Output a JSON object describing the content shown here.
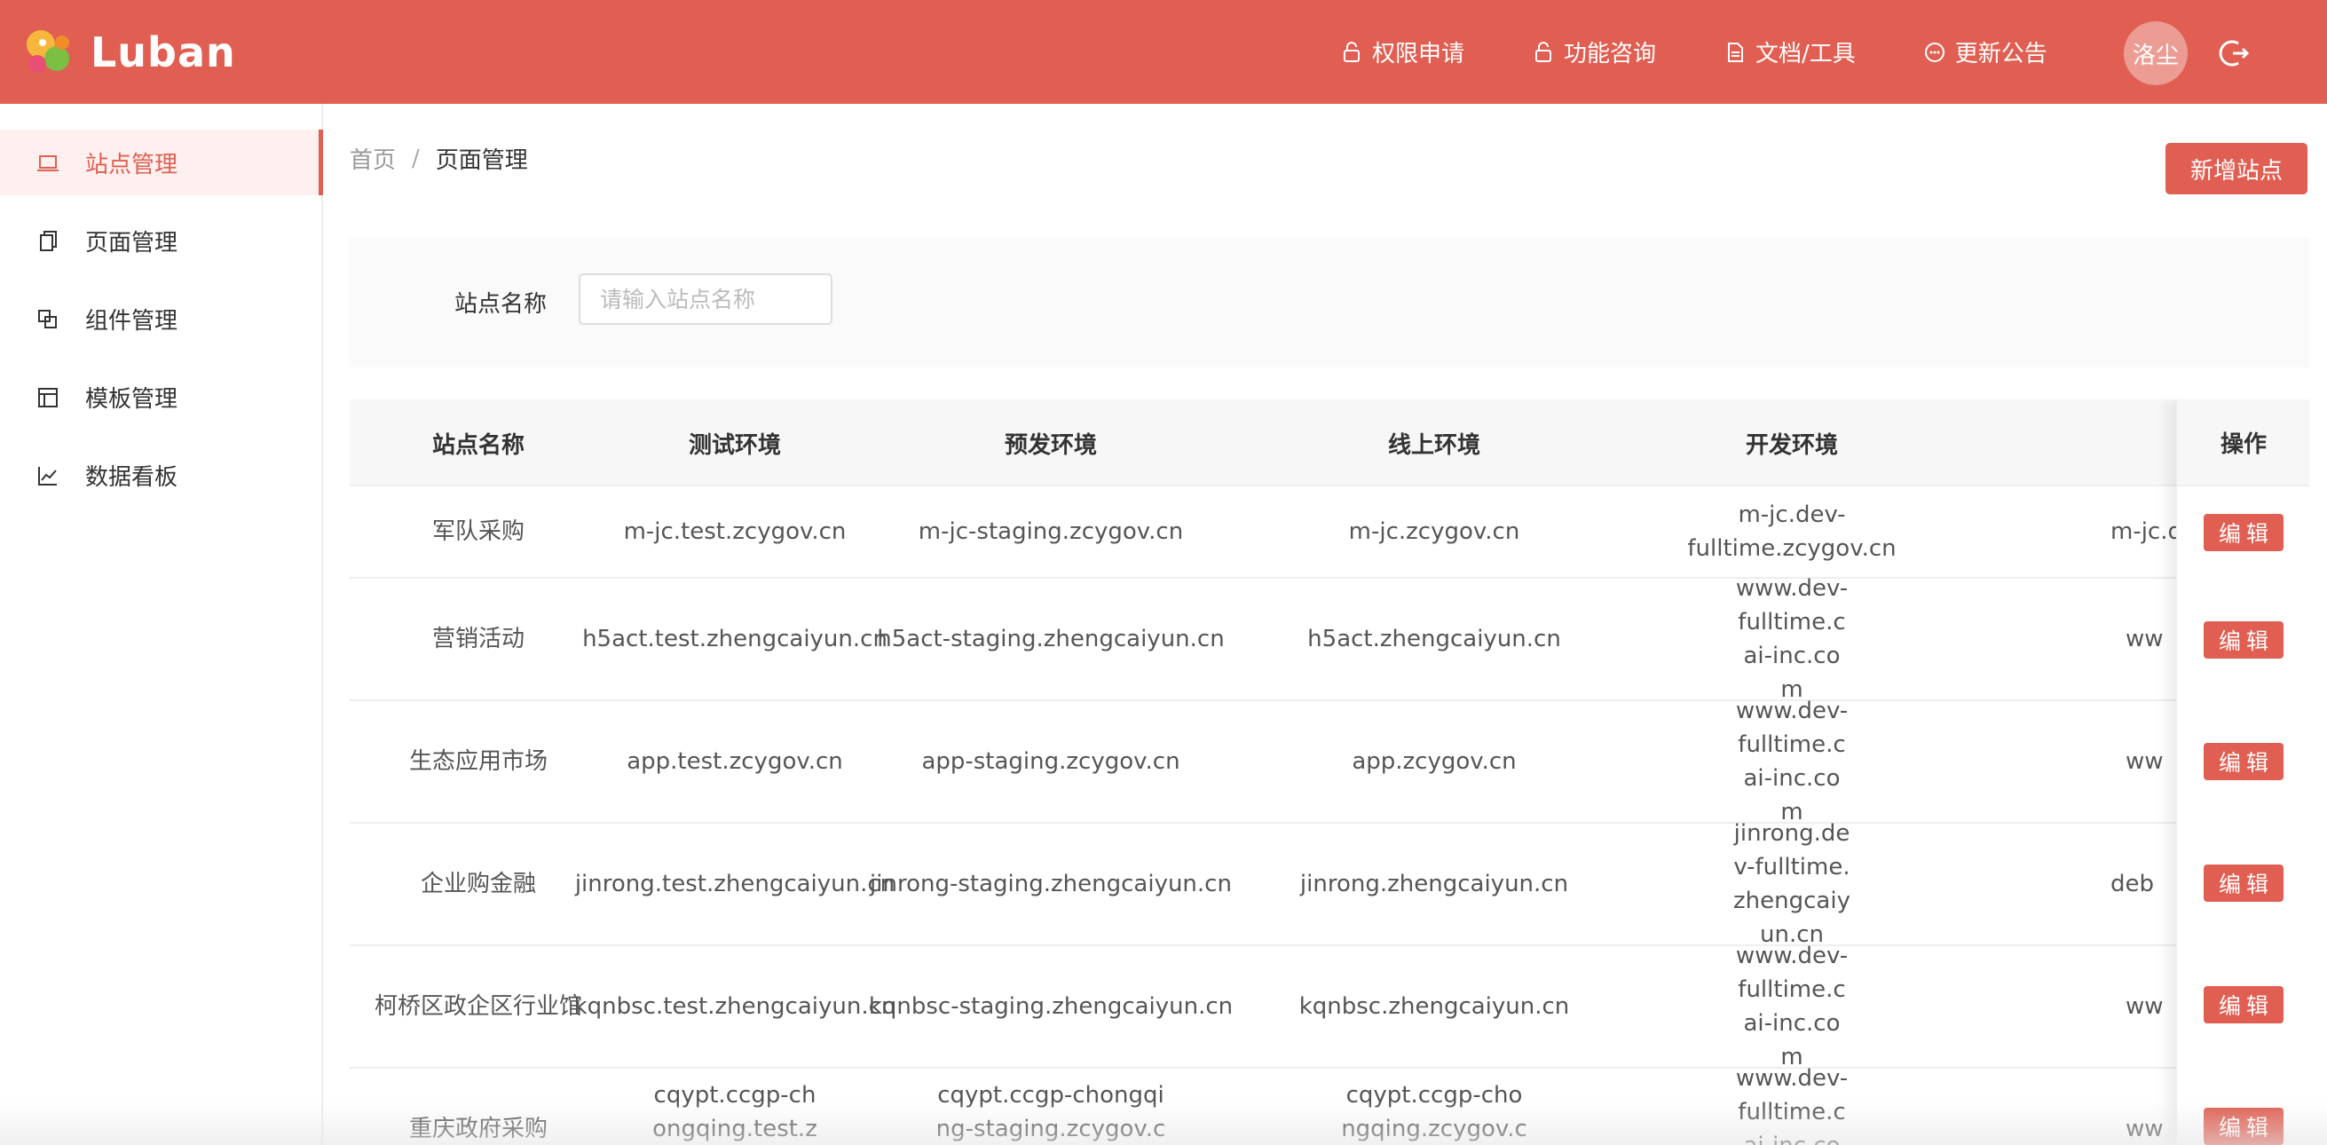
{
  "brand": {
    "name": "Luban"
  },
  "nav": {
    "items": [
      {
        "label": "权限申请",
        "icon": "lock-icon"
      },
      {
        "label": "功能咨询",
        "icon": "lock-icon"
      },
      {
        "label": "文档/工具",
        "icon": "document-icon"
      },
      {
        "label": "更新公告",
        "icon": "message-icon"
      }
    ],
    "user": "洛尘",
    "logout_icon": "logout-icon"
  },
  "sidebar": {
    "items": [
      {
        "label": "站点管理",
        "icon": "laptop-icon",
        "active": true
      },
      {
        "label": "页面管理",
        "icon": "copy-icon",
        "active": false
      },
      {
        "label": "组件管理",
        "icon": "component-icon",
        "active": false
      },
      {
        "label": "模板管理",
        "icon": "layout-icon",
        "active": false
      },
      {
        "label": "数据看板",
        "icon": "chart-line-icon",
        "active": false
      }
    ]
  },
  "breadcrumb": {
    "home": "首页",
    "sep": "/",
    "current": "页面管理"
  },
  "actions": {
    "add_site": "新增站点"
  },
  "filter": {
    "label": "站点名称",
    "placeholder": "请输入站点名称",
    "value": ""
  },
  "table": {
    "headers": [
      "站点名称",
      "测试环境",
      "预发环境",
      "线上环境",
      "开发环境",
      "操作"
    ],
    "rows": [
      {
        "name": "军队采购",
        "test": "m-jc.test.zcygov.cn",
        "staging": "m-jc-staging.zcygov.cn",
        "online": "m-jc.zcygov.cn",
        "dev": "m-jc.dev-fulltime.zcygov.cn",
        "extra": "m-jc.d",
        "edit": "编辑"
      },
      {
        "name": "营销活动",
        "test": "h5act.test.zhengcaiyun.cn",
        "staging": "h5act-staging.zhengcaiyun.cn",
        "online": "h5act.zhengcaiyun.cn",
        "dev": "www.dev-fulltime.cai-inc.com",
        "extra": "ww",
        "edit": "编辑"
      },
      {
        "name": "生态应用市场",
        "test": "app.test.zcygov.cn",
        "staging": "app-staging.zcygov.cn",
        "online": "app.zcygov.cn",
        "dev": "www.dev-fulltime.cai-inc.com",
        "extra": "ww",
        "edit": "编辑"
      },
      {
        "name": "企业购金融",
        "test": "jinrong.test.zhengcaiyun.cn",
        "staging": "jinrong-staging.zhengcaiyun.cn",
        "online": "jinrong.zhengcaiyun.cn",
        "dev": "jinrong.dev-fulltime.zhengcaiyun.cn",
        "extra": "deb",
        "edit": "编辑"
      },
      {
        "name": "柯桥区政企区行业馆",
        "test": "kqnbsc.test.zhengcaiyun.cn",
        "staging": "kqnbsc-staging.zhengcaiyun.cn",
        "online": "kqnbsc.zhengcaiyun.cn",
        "dev": "www.dev-fulltime.cai-inc.com",
        "extra": "ww",
        "edit": "编辑"
      },
      {
        "name": "重庆政府采购",
        "test": "cqypt.ccgp-chongqing.test.zcygov.cn",
        "staging": "cqypt.ccgp-chongqing-staging.zcygov.cn",
        "online": "cqypt.ccgp-chongqing.zcygov.cn",
        "dev": "www.dev-fulltime.cai-inc.com",
        "extra": "ww",
        "edit": "编辑"
      }
    ]
  },
  "colors": {
    "brand": "#e05f52",
    "active_bg": "#fdf0ef"
  }
}
